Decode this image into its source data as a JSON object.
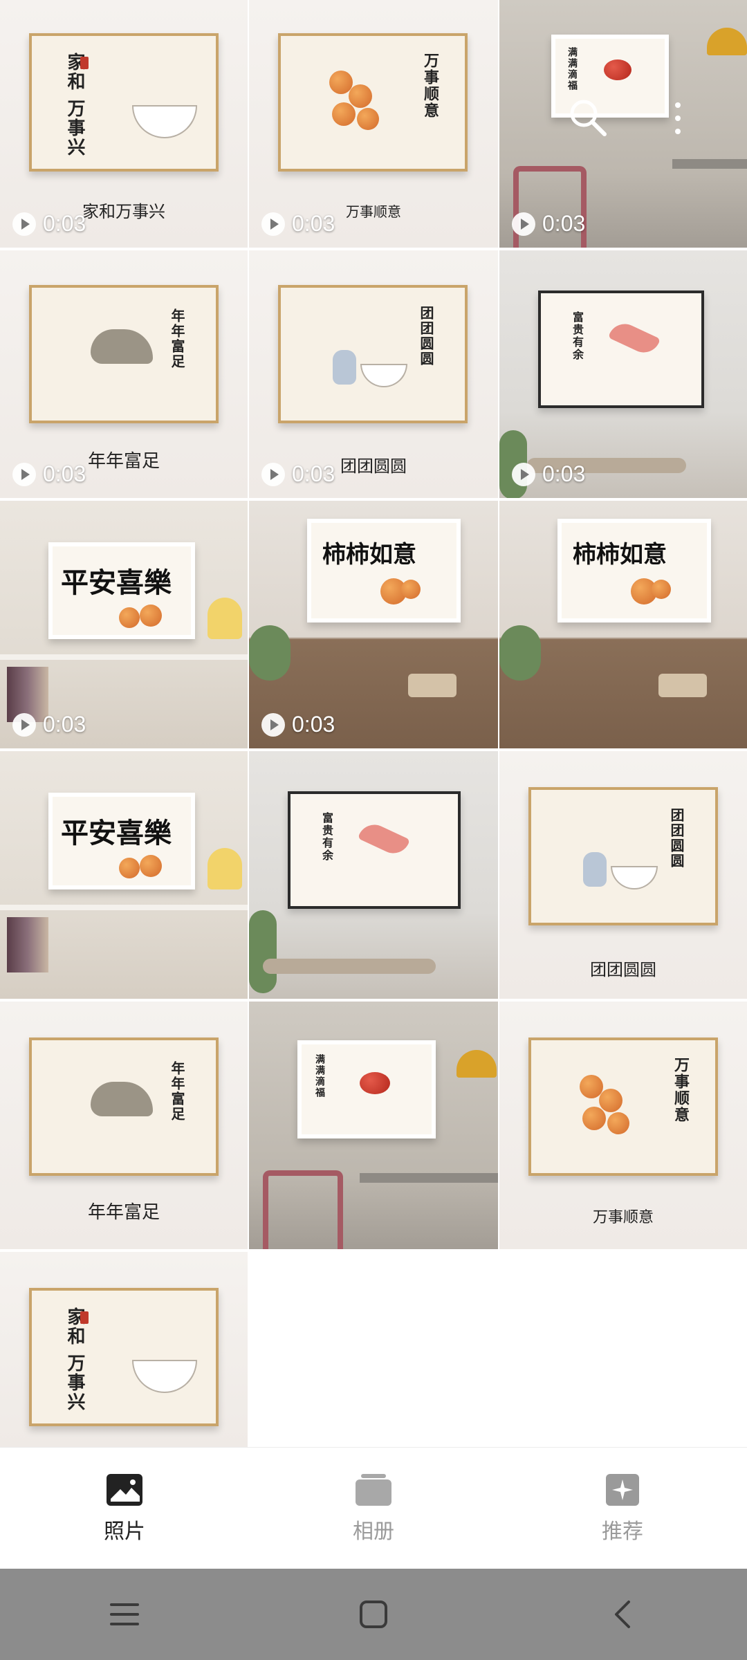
{
  "gallery": {
    "tiles": [
      {
        "caption": "家和万事兴",
        "duration": "0:03",
        "art_text": "家和 万事兴"
      },
      {
        "caption": "万事顺意",
        "duration": "0:03",
        "art_text": "万事顺意"
      },
      {
        "caption": "",
        "duration": "0:03",
        "art_text": "满满滴福"
      },
      {
        "caption": "年年富足",
        "duration": "0:03",
        "art_text": "年年富足"
      },
      {
        "caption": "团团圆圆",
        "duration": "0:03",
        "art_text": "团团圆圆"
      },
      {
        "caption": "",
        "duration": "0:03",
        "art_text": "富贵有余"
      },
      {
        "caption": "",
        "duration": "0:03",
        "art_text": "平安喜樂"
      },
      {
        "caption": "",
        "duration": "0:03",
        "art_text": "柿柿如意"
      },
      {
        "caption": "",
        "duration": "",
        "art_text": "柿柿如意"
      },
      {
        "caption": "",
        "duration": "",
        "art_text": "平安喜樂"
      },
      {
        "caption": "",
        "duration": "",
        "art_text": "富贵有余"
      },
      {
        "caption": "团团圆圆",
        "duration": "",
        "art_text": "团团圆圆"
      },
      {
        "caption": "年年富足",
        "duration": "",
        "art_text": "年年富足"
      },
      {
        "caption": "",
        "duration": "",
        "art_text": "满满滴福"
      },
      {
        "caption": "万事顺意",
        "duration": "",
        "art_text": "万事顺意"
      },
      {
        "caption": "",
        "duration": "",
        "art_text": "家和 万事兴"
      }
    ]
  },
  "overlay_icons": [
    "search-icon",
    "more-vertical-icon"
  ],
  "bottom_nav": {
    "items": [
      {
        "label": "照片",
        "icon": "photo-icon",
        "active": true
      },
      {
        "label": "相册",
        "icon": "album-icon",
        "active": false
      },
      {
        "label": "推荐",
        "icon": "sparkle-icon",
        "active": false
      }
    ]
  },
  "system_nav": [
    "menu-icon",
    "home-icon",
    "back-icon"
  ],
  "colors": {
    "accent": "#222222",
    "inactive": "#9a9a9a",
    "frame_gold": "#c9a46a",
    "system_bar": "#8c8c8c"
  }
}
